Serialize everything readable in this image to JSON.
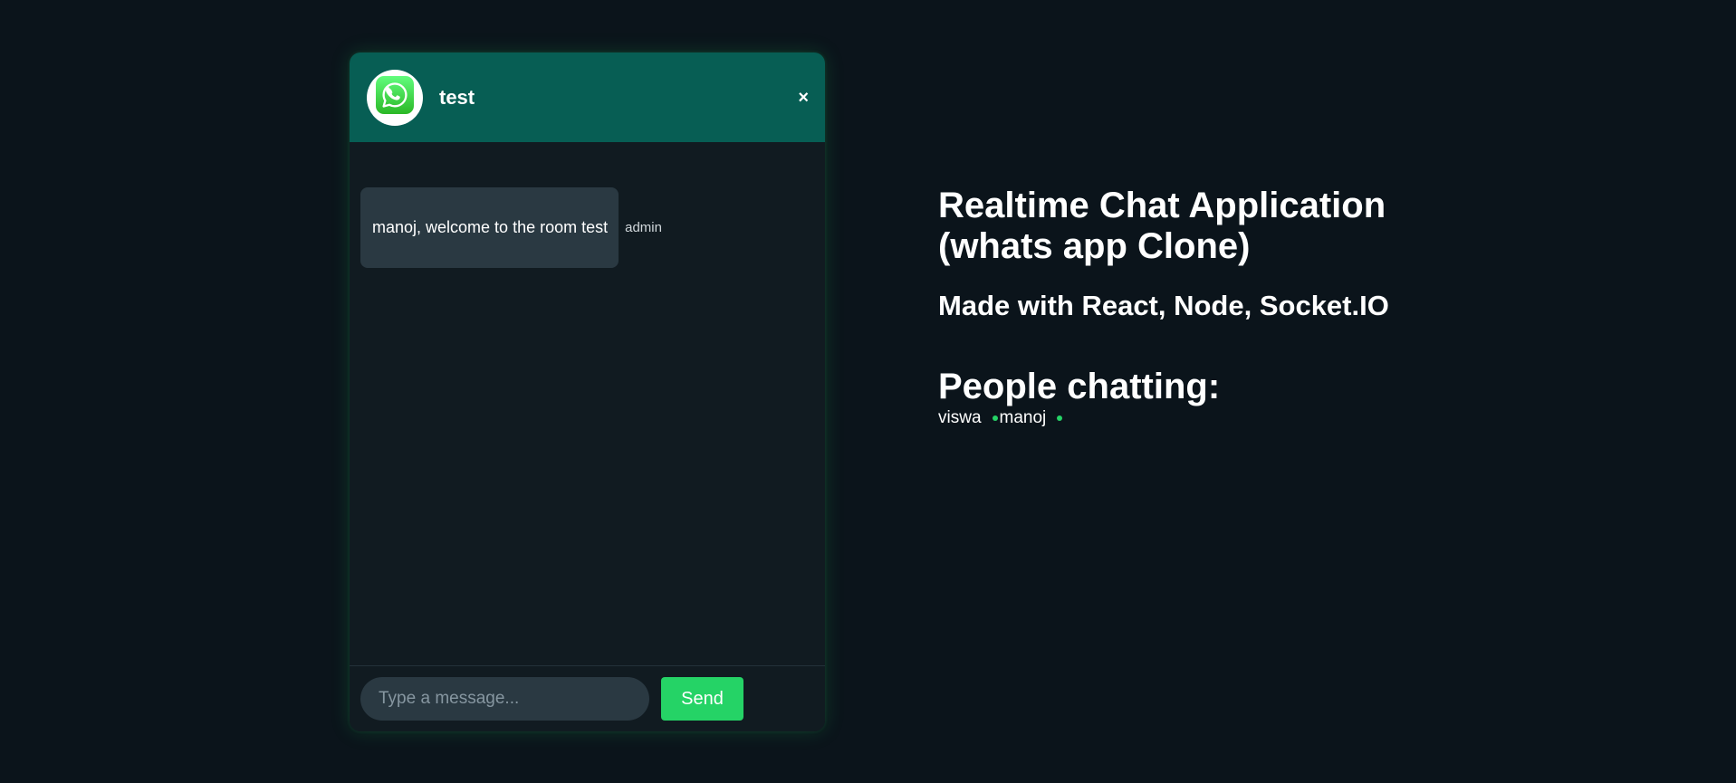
{
  "colors": {
    "page_background": "#0b141b",
    "header": "#075e54",
    "accent": "#25d366",
    "bubble": "#2a3942",
    "chat_background": "#111b21"
  },
  "chat": {
    "avatar_icon": "whatsapp-logo-icon",
    "room_name": "test",
    "close_label": "×",
    "messages": [
      {
        "text": "manoj, welcome to the room test",
        "sender": "admin"
      }
    ],
    "input": {
      "placeholder": "Type a message...",
      "value": ""
    },
    "send_label": "Send"
  },
  "info": {
    "title": "Realtime Chat Application (whats app Clone)",
    "subtitle": "Made with React, Node, Socket.IO",
    "people_heading": "People chatting:",
    "people": [
      {
        "name": "viswa",
        "status": "online"
      },
      {
        "name": "manoj",
        "status": "online"
      }
    ]
  }
}
